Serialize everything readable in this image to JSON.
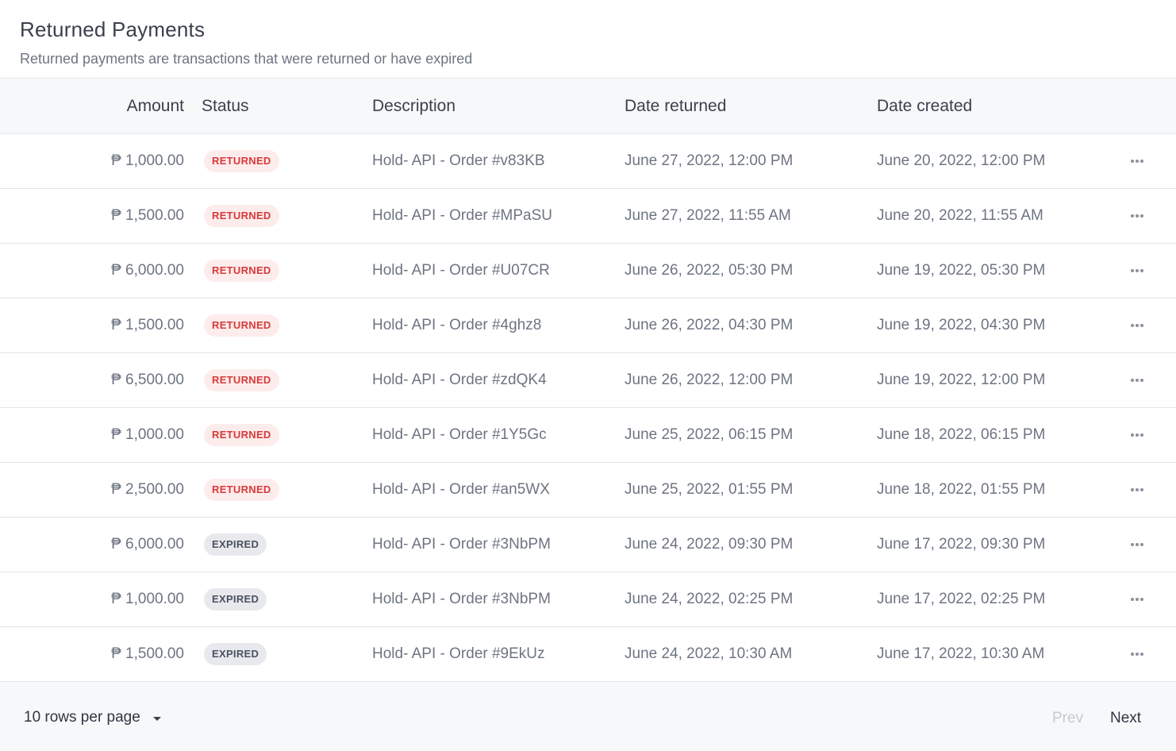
{
  "header": {
    "title": "Returned Payments",
    "subtitle": "Returned payments are transactions that were returned or have expired"
  },
  "table": {
    "columns": {
      "amount": "Amount",
      "status": "Status",
      "description": "Description",
      "date_returned": "Date returned",
      "date_created": "Date created"
    },
    "rows": [
      {
        "amount": "₱ 1,000.00",
        "status": "RETURNED",
        "status_type": "returned",
        "description": "Hold- API - Order #v83KB",
        "date_returned": "June  27, 2022, 12:00 PM",
        "date_created": "June  20, 2022, 12:00 PM"
      },
      {
        "amount": "₱ 1,500.00",
        "status": "RETURNED",
        "status_type": "returned",
        "description": "Hold- API - Order #MPaSU",
        "date_returned": "June 27, 2022, 11:55 AM",
        "date_created": "June 20, 2022, 11:55 AM"
      },
      {
        "amount": "₱ 6,000.00",
        "status": "RETURNED",
        "status_type": "returned",
        "description": "Hold- API - Order #U07CR",
        "date_returned": "June 26, 2022, 05:30 PM",
        "date_created": "June 19, 2022, 05:30 PM"
      },
      {
        "amount": "₱ 1,500.00",
        "status": "RETURNED",
        "status_type": "returned",
        "description": "Hold- API - Order #4ghz8",
        "date_returned": "June 26, 2022, 04:30 PM",
        "date_created": "June 19, 2022, 04:30 PM"
      },
      {
        "amount": "₱ 6,500.00",
        "status": "RETURNED",
        "status_type": "returned",
        "description": "Hold- API - Order #zdQK4",
        "date_returned": "June 26, 2022, 12:00 PM",
        "date_created": "June 19, 2022, 12:00 PM"
      },
      {
        "amount": "₱ 1,000.00",
        "status": "RETURNED",
        "status_type": "returned",
        "description": "Hold- API - Order #1Y5Gc",
        "date_returned": "June 25, 2022, 06:15 PM",
        "date_created": "June 18, 2022, 06:15 PM"
      },
      {
        "amount": "₱ 2,500.00",
        "status": "RETURNED",
        "status_type": "returned",
        "description": "Hold- API - Order #an5WX",
        "date_returned": "June 25, 2022, 01:55 PM",
        "date_created": "June 18, 2022, 01:55 PM"
      },
      {
        "amount": "₱ 6,000.00",
        "status": "EXPIRED",
        "status_type": "expired",
        "description": "Hold- API - Order #3NbPM",
        "date_returned": "June 24, 2022, 09:30 PM",
        "date_created": "June 17, 2022, 09:30 PM"
      },
      {
        "amount": "₱ 1,000.00",
        "status": "EXPIRED",
        "status_type": "expired",
        "description": "Hold- API - Order #3NbPM",
        "date_returned": "June 24, 2022, 02:25 PM",
        "date_created": "June 17, 2022, 02:25 PM"
      },
      {
        "amount": "₱ 1,500.00",
        "status": "EXPIRED",
        "status_type": "expired",
        "description": "Hold- API - Order #9EkUz",
        "date_returned": "June 24, 2022, 10:30 AM",
        "date_created": "June 17, 2022, 10:30 AM"
      }
    ],
    "row_action_icon": "more-horizontal-icon"
  },
  "footer": {
    "rows_per_page": "10 rows per page",
    "caret_icon": "caret-down-icon",
    "prev_label": "Prev",
    "next_label": "Next"
  },
  "colors": {
    "returned_badge_bg": "#fdecec",
    "returned_badge_text": "#d83a3a",
    "expired_badge_bg": "#e7e9ed",
    "expired_badge_text": "#4a5160",
    "header_bg": "#f7f8fa"
  }
}
